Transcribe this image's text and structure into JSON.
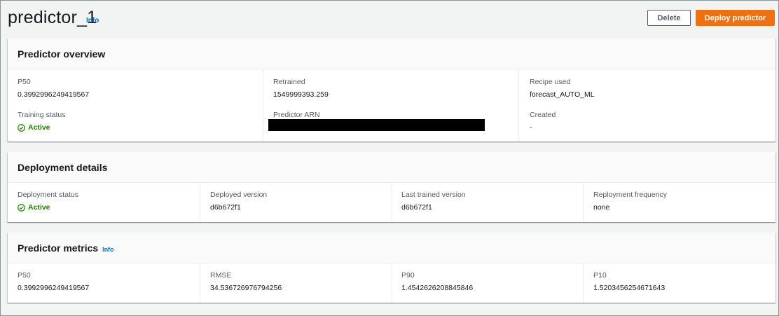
{
  "header": {
    "title": "predictor_1",
    "info_label": "Info",
    "delete_label": "Delete",
    "deploy_label": "Deploy predictor"
  },
  "overview": {
    "title": "Predictor overview",
    "p50_label": "P50",
    "p50_value": "0.3992996249419567",
    "retrained_label": "Retrained",
    "retrained_value": "1549999393.259",
    "recipe_label": "Recipe used",
    "recipe_value": "forecast_AUTO_ML",
    "training_status_label": "Training status",
    "training_status_value": "Active",
    "arn_label": "Predictor ARN",
    "created_label": "Created",
    "created_value": "-"
  },
  "deployment": {
    "title": "Deployment details",
    "status_label": "Deployment status",
    "status_value": "Active",
    "deployed_version_label": "Deployed version",
    "deployed_version_value": "d6b672f1",
    "last_trained_label": "Last trained version",
    "last_trained_value": "d6b672f1",
    "frequency_label": "Reployment frequency",
    "frequency_value": "none"
  },
  "metrics": {
    "title": "Predictor metrics",
    "info_label": "Info",
    "p50_label": "P50",
    "p50_value": "0.3992996249419567",
    "rmse_label": "RMSE",
    "rmse_value": "34.536726976794256",
    "p90_label": "P90",
    "p90_value": "1.4542626208845846",
    "p10_label": "P10",
    "p10_value": "1.5203456254671643"
  },
  "colors": {
    "accent": "#ec7211",
    "link": "#0073bb",
    "success": "#1d8102"
  }
}
